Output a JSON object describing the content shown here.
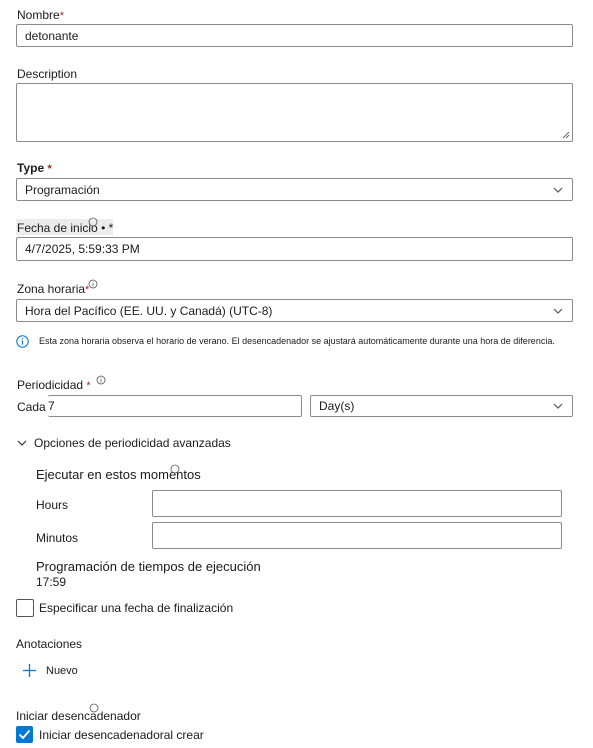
{
  "name": {
    "label": "Nombre",
    "required_mark": "*",
    "value": "detonante"
  },
  "description": {
    "label": "Description",
    "value": ""
  },
  "type": {
    "label": "Type",
    "required_mark": "*",
    "value": "Programación"
  },
  "start_date": {
    "label": "Fecha de inicio",
    "suffix": "• *",
    "value": "4/7/2025, 5:59:33 PM"
  },
  "timezone": {
    "label": "Zona horaria",
    "required_mark": "*",
    "value": "Hora del Pacífico (EE. UU. y Canadá) (UTC-8)",
    "note": "Esta zona horaria observa el horario de verano. El desencadenador se ajustará automáticamente durante una hora de diferencia."
  },
  "recurrence": {
    "label": "Periodicidad",
    "required_mark": "*",
    "every_label": "Cada",
    "interval": "7",
    "unit": "Day(s)"
  },
  "advanced": {
    "toggle_label": "Opciones de periodicidad avanzadas",
    "run_at_label": "Ejecutar en estos momentos",
    "hours_label": "Hours",
    "hours_value": "",
    "minutes_label": "Minutos",
    "minutes_value": "",
    "schedule_title": "Programación de tiempos de ejecución",
    "schedule_value": "17:59"
  },
  "end_date": {
    "label": "Especificar una fecha de finalización",
    "checked": false
  },
  "annotations": {
    "label": "Anotaciones",
    "new_label": "Nuevo"
  },
  "activation": {
    "label": "Iniciar desencadenador",
    "checkbox_label": "Iniciar desencadenadoral crear",
    "checked": true
  },
  "colors": {
    "accent": "#0078d4",
    "required": "#a4262c",
    "border": "#8a8a8a"
  }
}
